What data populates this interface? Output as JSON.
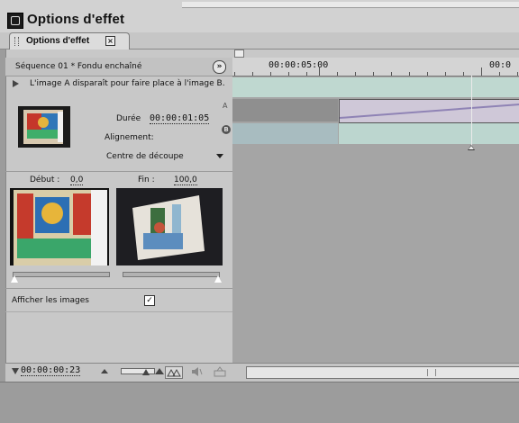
{
  "window": {
    "title": "Options d'effet"
  },
  "tab": {
    "label": "Options d'effet",
    "close": "×"
  },
  "panel": {
    "sequence": "Séquence 01 * Fondu enchaîné",
    "menu_icon": "»",
    "description": "L'image A disparaît pour faire place à l'image B.",
    "duration_label": "Durée",
    "duration_value": "00:00:01:05",
    "alignment_label": "Alignement:",
    "alignment_value": "Centre de découpe",
    "start_label": "Début :",
    "start_value": "0,0",
    "end_label": "Fin :",
    "end_value": "100,0",
    "show_images_label": "Afficher les images",
    "show_images_checked": true,
    "check_mark": "✓",
    "bottom_time": "00:00:00:23"
  },
  "timeline": {
    "ruler_labels": [
      "00:00:05:00",
      "00:0"
    ],
    "track_a_label": "A",
    "track_b_label": "B"
  },
  "colors": {
    "panel_bg": "#c8c8c8",
    "track_a_teal": "#bfd8d0",
    "clip_lilac": "#cfc8d8",
    "track_b_blue": "#a8bcc0"
  }
}
